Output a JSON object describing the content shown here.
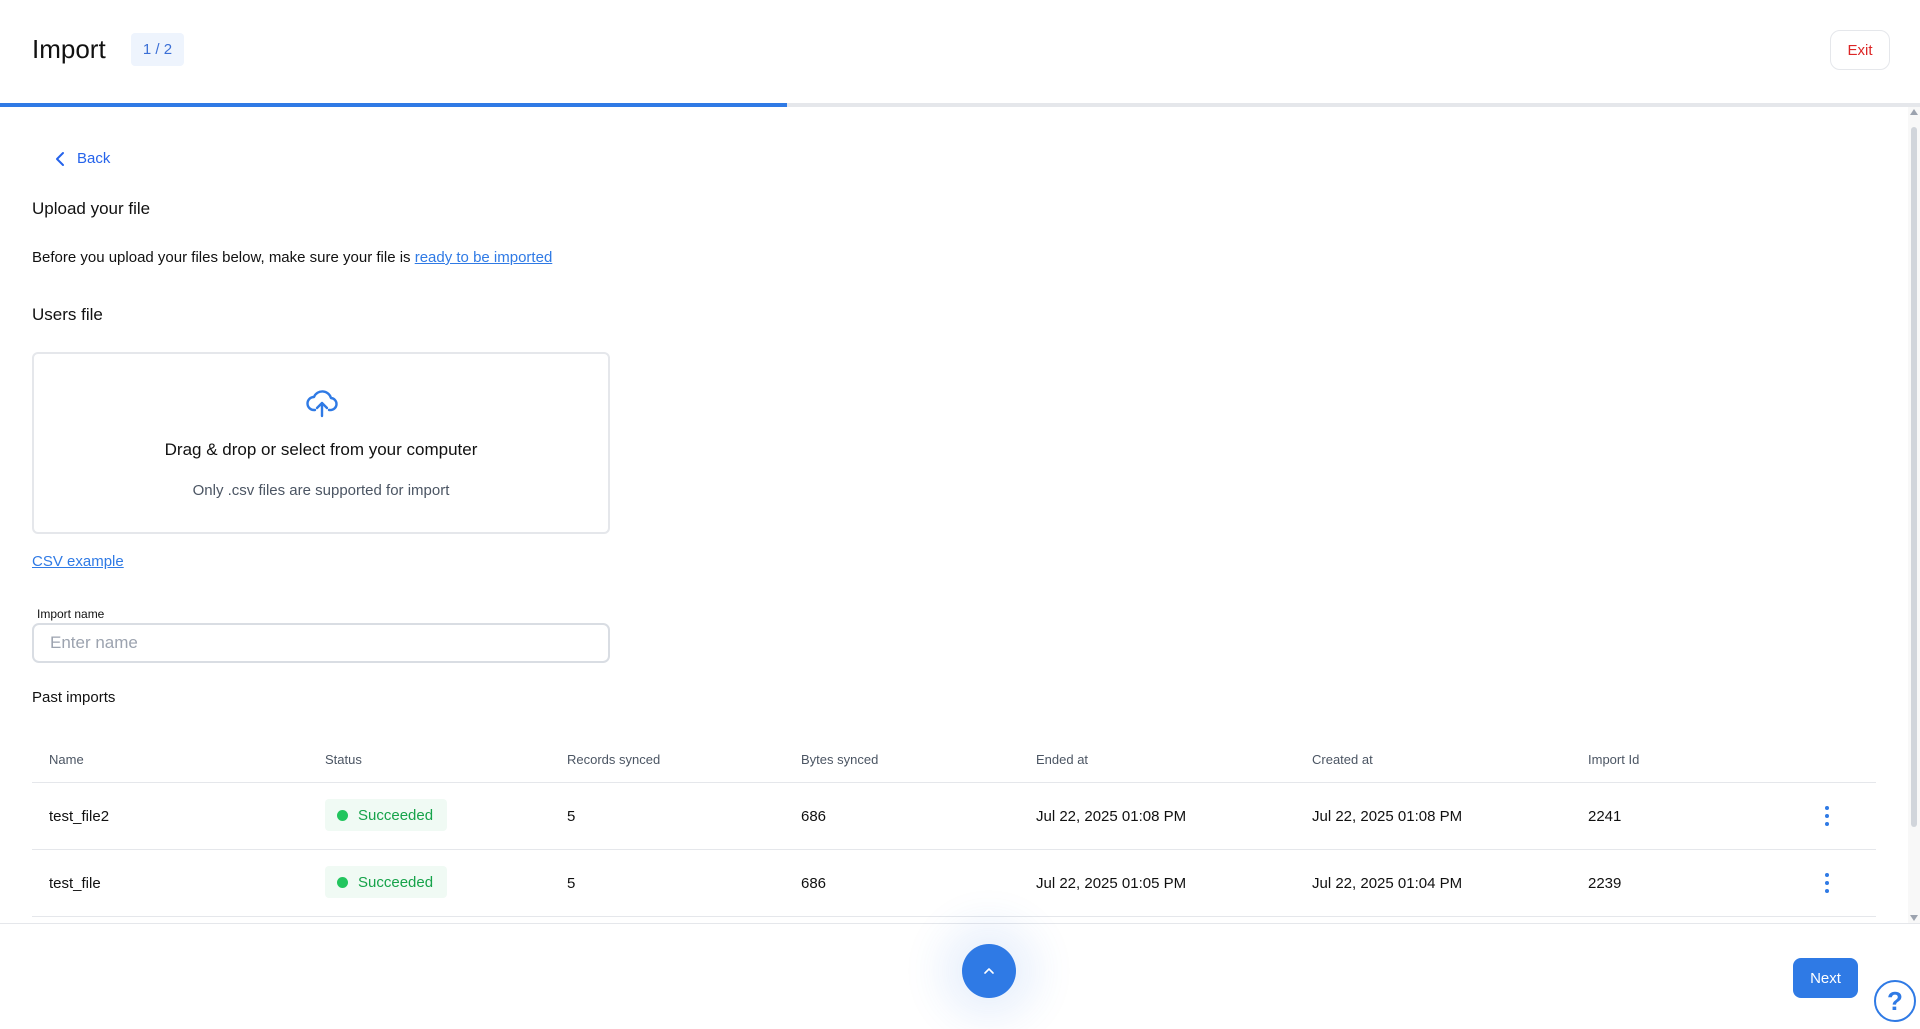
{
  "header": {
    "title": "Import",
    "step": "1 / 2",
    "exit_label": "Exit",
    "progress_fraction": 0.41
  },
  "nav": {
    "back_label": "Back"
  },
  "upload": {
    "heading": "Upload your file",
    "description": "Before you upload your files below, make sure your file is ",
    "description_link": "ready to be imported",
    "users_heading": "Users file",
    "dropzone_title": "Drag & drop or select from your computer",
    "dropzone_subtitle": "Only .csv files are supported for import",
    "upload_icon": "cloud-upload-icon",
    "csv_example_link": "CSV example"
  },
  "import_name": {
    "label": "Import name",
    "placeholder": "Enter name",
    "value": ""
  },
  "past_imports": {
    "heading": "Past imports",
    "columns": [
      "Name",
      "Status",
      "Records synced",
      "Bytes synced",
      "Ended at",
      "Created at",
      "Import Id"
    ],
    "rows": [
      {
        "name": "test_file2",
        "status": "Succeeded",
        "records": "5",
        "bytes": "686",
        "ended": "Jul 22, 2025 01:08 PM",
        "created": "Jul 22, 2025 01:08 PM",
        "id": "2241"
      },
      {
        "name": "test_file",
        "status": "Succeeded",
        "records": "5",
        "bytes": "686",
        "ended": "Jul 22, 2025 01:05 PM",
        "created": "Jul 22, 2025 01:04 PM",
        "id": "2239"
      }
    ]
  },
  "footer": {
    "next_label": "Next",
    "help_label": "?",
    "scroll_top_icon": "chevron-up-icon"
  },
  "colors": {
    "accent": "#2f7ae5",
    "danger": "#dc2626",
    "success": "#16a34a"
  }
}
